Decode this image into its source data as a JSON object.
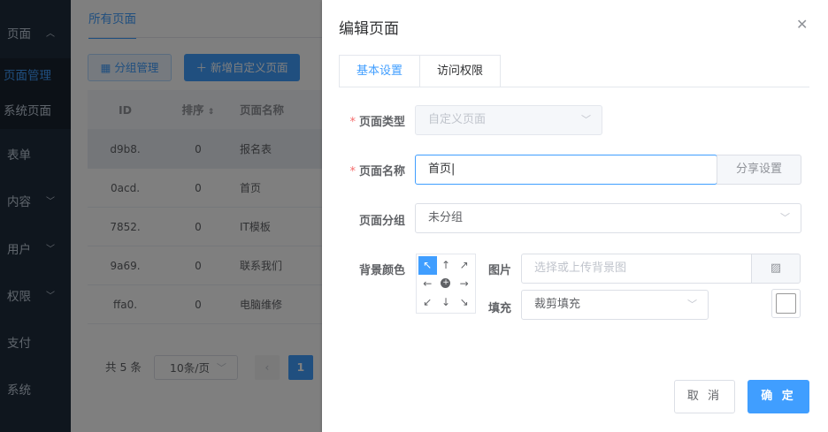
{
  "sidebar": {
    "page_label": "页面",
    "page_manage": "页面管理",
    "system_pages": "系统页面",
    "form": "表单",
    "content": "内容",
    "user": "用户",
    "permission": "权限",
    "payment": "支付",
    "system": "系统"
  },
  "main": {
    "tab_all": "所有页面",
    "btn_group": "分组管理",
    "btn_add": "新增自定义页面",
    "table": {
      "headers": [
        "ID",
        "排序",
        "页面名称"
      ],
      "rows": [
        {
          "id": "d9b8.",
          "order": "0",
          "name": "报名表"
        },
        {
          "id": "0acd.",
          "order": "0",
          "name": "首页"
        },
        {
          "id": "7852.",
          "order": "0",
          "name": "IT模板"
        },
        {
          "id": "9a69.",
          "order": "0",
          "name": "联系我们"
        },
        {
          "id": "ffa0.",
          "order": "0",
          "name": "电脑维修"
        }
      ]
    },
    "pager": {
      "total": "共 5 条",
      "size": "10条/页",
      "current": "1"
    }
  },
  "dialog": {
    "title": "编辑页面",
    "tabs": [
      "基本设置",
      "访问权限"
    ],
    "page_type_label": "页面类型",
    "page_type_value": "自定义页面",
    "page_name_label": "页面名称",
    "page_name_value": "首页|",
    "share_button": "分享设置",
    "page_group_label": "页面分组",
    "page_group_value": "未分组",
    "bg_color_label": "背景颜色",
    "image_label": "图片",
    "image_placeholder": "选择或上传背景图",
    "fill_label": "填充",
    "fill_value": "裁剪填充",
    "cancel": "取 消",
    "ok": "确 定"
  },
  "colors": {
    "primary": "#409eff",
    "sidebar_bg": "#1f2d3d",
    "required": "#f56c6c"
  }
}
